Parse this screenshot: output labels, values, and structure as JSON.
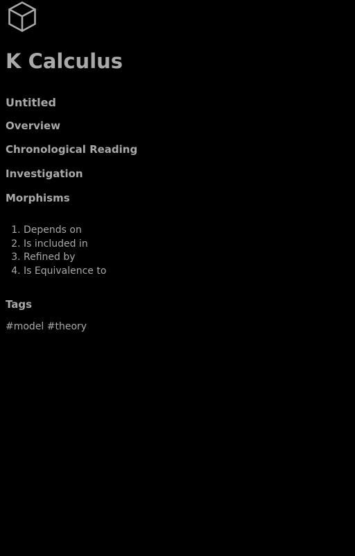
{
  "header": {
    "logo_icon": "cube-icon",
    "title": "K Calculus"
  },
  "subtitle": "Untitled",
  "sections": {
    "overview": "Overview",
    "chronological_reading": "Chronological Reading",
    "investigation": "Investigation",
    "morphisms": "Morphisms",
    "tags": "Tags"
  },
  "morphisms": {
    "items": [
      {
        "number": "1.",
        "label": "Depends on"
      },
      {
        "number": "2.",
        "label": "Is included in"
      },
      {
        "number": "3.",
        "label": "Refined by"
      },
      {
        "number": "4.",
        "label": "Is Equivalence to"
      }
    ]
  },
  "tags": {
    "items": [
      "#model",
      "#theory"
    ]
  },
  "colors": {
    "background": "#000000",
    "text": "#a9a9a9"
  }
}
